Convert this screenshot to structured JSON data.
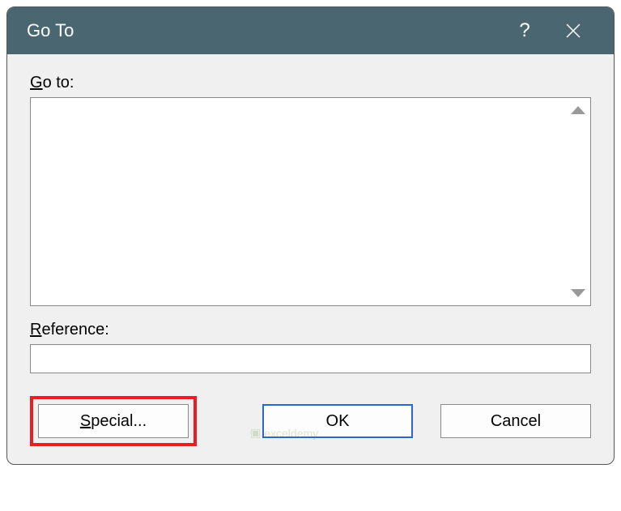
{
  "titlebar": {
    "title": "Go To",
    "help": "?",
    "close": "✕"
  },
  "labels": {
    "goto_prefix": "G",
    "goto_rest": "o to:",
    "reference_prefix": "R",
    "reference_rest": "eference:"
  },
  "inputs": {
    "listbox_value": "",
    "reference_value": ""
  },
  "buttons": {
    "special_prefix": "S",
    "special_rest": "pecial...",
    "ok": "OK",
    "cancel": "Cancel"
  },
  "watermark": "exceldemy"
}
